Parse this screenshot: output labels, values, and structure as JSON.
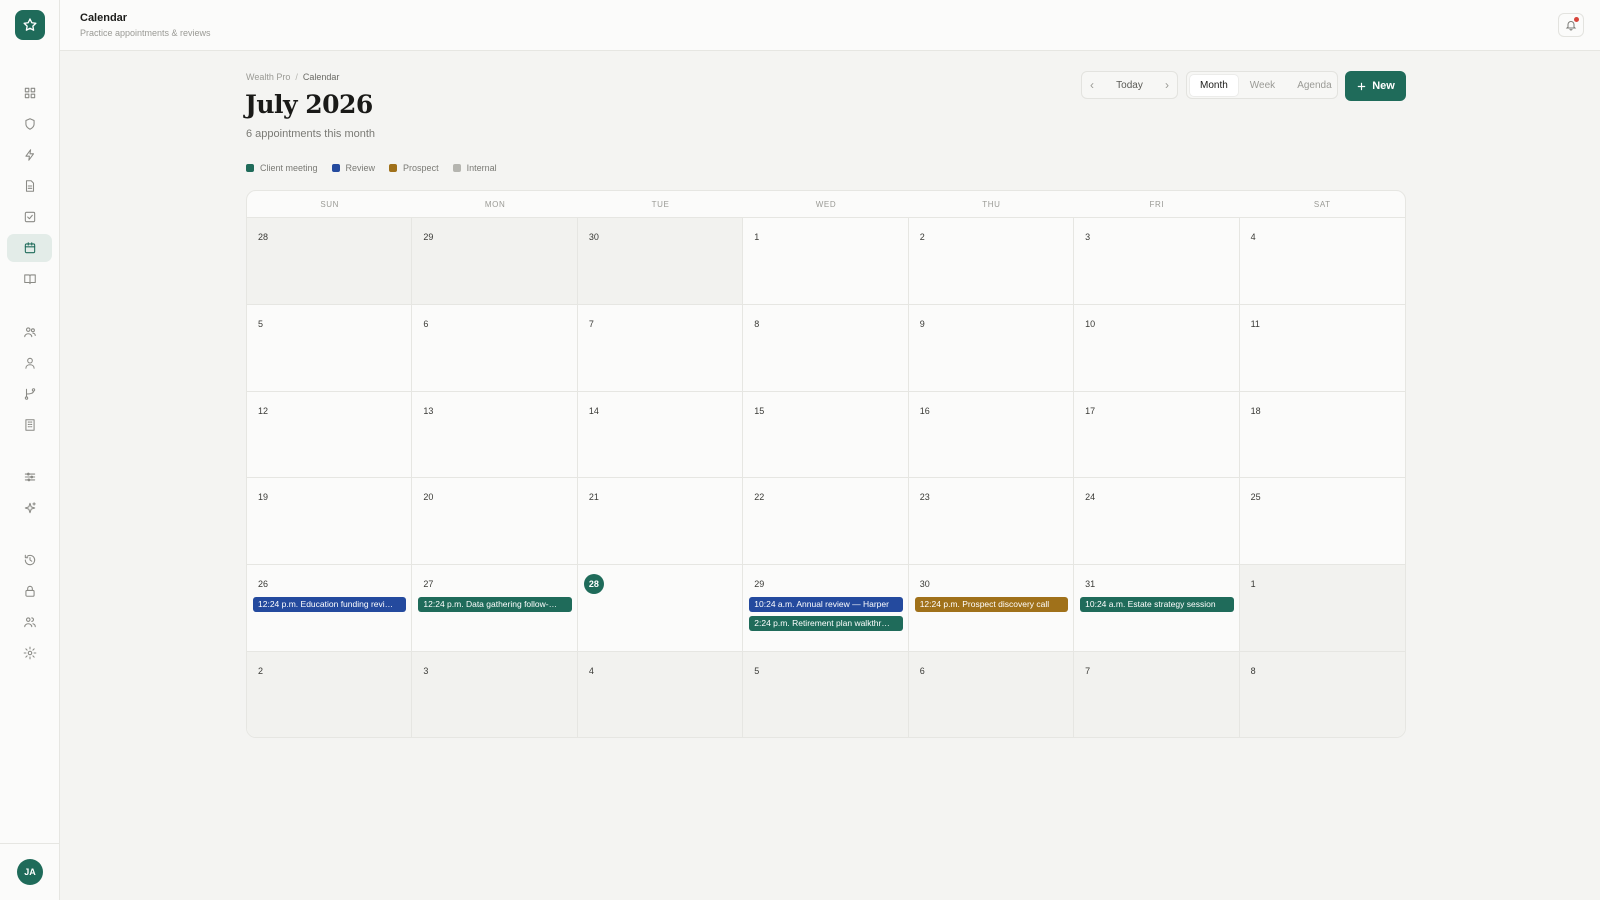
{
  "app": {
    "title": "Calendar",
    "subtitle": "Practice appointments & reviews",
    "avatar_initials": "JA",
    "logo_icon": "star-icon",
    "accent_color": "#1f6b5a"
  },
  "sidebar": {
    "items": [
      {
        "name": "dashboard",
        "icon": "grid-icon",
        "active": false
      },
      {
        "name": "compliance",
        "icon": "shield-icon",
        "active": false
      },
      {
        "name": "activity",
        "icon": "lightning-icon",
        "active": false
      },
      {
        "name": "documents",
        "icon": "document-icon",
        "active": false
      },
      {
        "name": "tasks",
        "icon": "checkbox-icon",
        "active": false
      },
      {
        "name": "calendar",
        "icon": "calendar-icon",
        "active": true
      },
      {
        "name": "library",
        "icon": "book-icon",
        "active": false
      },
      {
        "name": "clients",
        "icon": "users-icon",
        "active": false
      },
      {
        "name": "contacts",
        "icon": "user-icon",
        "active": false
      },
      {
        "name": "workflows",
        "icon": "branch-icon",
        "active": false
      },
      {
        "name": "firms",
        "icon": "building-icon",
        "active": false
      },
      {
        "name": "filters",
        "icon": "sliders-icon",
        "active": false
      },
      {
        "name": "ai",
        "icon": "sparkle-icon",
        "active": false
      },
      {
        "name": "history",
        "icon": "history-icon",
        "active": false
      },
      {
        "name": "security",
        "icon": "lock-icon",
        "active": false
      },
      {
        "name": "team",
        "icon": "team-icon",
        "active": false
      },
      {
        "name": "settings",
        "icon": "gear-icon",
        "active": false
      }
    ]
  },
  "breadcrumb": {
    "root": "Wealth Pro",
    "separator": "/",
    "current": "Calendar"
  },
  "header": {
    "title": "July 2026",
    "subtitle": "6 appointments this month"
  },
  "legend": [
    {
      "label": "Client meeting",
      "color": "#1f6b5a"
    },
    {
      "label": "Review",
      "color": "#244a9e"
    },
    {
      "label": "Prospect",
      "color": "#a0711a"
    },
    {
      "label": "Internal",
      "color": "#b5b5b0"
    }
  ],
  "controls": {
    "today_label": "Today",
    "views": [
      {
        "label": "Month",
        "active": true
      },
      {
        "label": "Week",
        "active": false
      },
      {
        "label": "Agenda",
        "active": false
      }
    ],
    "new_label": "New"
  },
  "calendar": {
    "weekdays": [
      "SUN",
      "MON",
      "TUE",
      "WED",
      "THU",
      "FRI",
      "SAT"
    ],
    "today": "28",
    "days": [
      {
        "day": "28",
        "outside": true
      },
      {
        "day": "29",
        "outside": true
      },
      {
        "day": "30",
        "outside": true
      },
      {
        "day": "1"
      },
      {
        "day": "2"
      },
      {
        "day": "3"
      },
      {
        "day": "4"
      },
      {
        "day": "5"
      },
      {
        "day": "6"
      },
      {
        "day": "7"
      },
      {
        "day": "8"
      },
      {
        "day": "9"
      },
      {
        "day": "10"
      },
      {
        "day": "11"
      },
      {
        "day": "12"
      },
      {
        "day": "13"
      },
      {
        "day": "14"
      },
      {
        "day": "15"
      },
      {
        "day": "16"
      },
      {
        "day": "17"
      },
      {
        "day": "18"
      },
      {
        "day": "19"
      },
      {
        "day": "20"
      },
      {
        "day": "21"
      },
      {
        "day": "22"
      },
      {
        "day": "23"
      },
      {
        "day": "24"
      },
      {
        "day": "25"
      },
      {
        "day": "26",
        "events": [
          {
            "label": "12:24 p.m. Education funding revi…",
            "type": "Review"
          }
        ]
      },
      {
        "day": "27",
        "events": [
          {
            "label": "12:24 p.m. Data gathering follow-…",
            "type": "Client meeting"
          }
        ]
      },
      {
        "day": "28",
        "today": true
      },
      {
        "day": "29",
        "events": [
          {
            "label": "10:24 a.m. Annual review — Harper",
            "type": "Review"
          },
          {
            "label": "2:24 p.m. Retirement plan walkthr…",
            "type": "Client meeting"
          }
        ]
      },
      {
        "day": "30",
        "events": [
          {
            "label": "12:24 p.m. Prospect discovery call",
            "type": "Prospect"
          }
        ]
      },
      {
        "day": "31",
        "events": [
          {
            "label": "10:24 a.m. Estate strategy session",
            "type": "Client meeting"
          }
        ]
      },
      {
        "day": "1",
        "outside": true
      },
      {
        "day": "2",
        "outside": true
      },
      {
        "day": "3",
        "outside": true
      },
      {
        "day": "4",
        "outside": true
      },
      {
        "day": "5",
        "outside": true
      },
      {
        "day": "6",
        "outside": true
      },
      {
        "day": "7",
        "outside": true
      },
      {
        "day": "8",
        "outside": true
      }
    ]
  }
}
